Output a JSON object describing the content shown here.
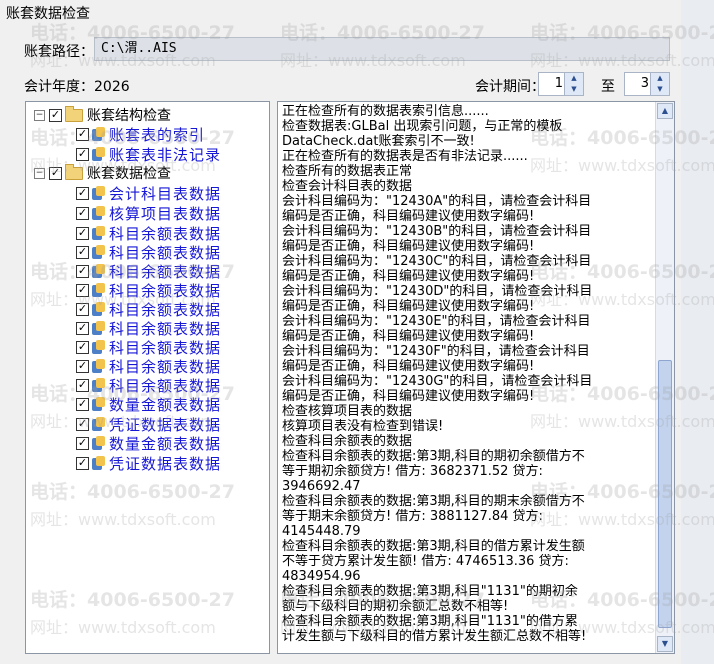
{
  "window": {
    "title": "账套数据检查"
  },
  "path": {
    "label": "账套路径：",
    "value": "C:\\渭..AIS"
  },
  "fiscal_year": {
    "label": "会计年度：",
    "value": "2026"
  },
  "period": {
    "label": "会计期间：",
    "from": "1",
    "to_label": "至",
    "to": "3"
  },
  "tree": {
    "items": [
      {
        "label": "账套结构检查",
        "level": 0,
        "type": "folder",
        "checked": true,
        "expander": "−"
      },
      {
        "label": "账套表的索引",
        "level": 1,
        "type": "db",
        "checked": true
      },
      {
        "label": "账套表非法记录",
        "level": 1,
        "type": "db",
        "checked": true
      },
      {
        "label": "账套数据检查",
        "level": 0,
        "type": "folder",
        "checked": true,
        "expander": "−"
      },
      {
        "label": "会计科目表数据",
        "level": 1,
        "type": "db",
        "checked": true
      },
      {
        "label": "核算项目表数据",
        "level": 1,
        "type": "db",
        "checked": true
      },
      {
        "label": "科目余额表数据",
        "level": 1,
        "type": "db",
        "checked": true
      },
      {
        "label": "科目余额表数据",
        "level": 1,
        "type": "db",
        "checked": true
      },
      {
        "label": "科目余额表数据",
        "level": 1,
        "type": "db",
        "checked": true
      },
      {
        "label": "科目余额表数据",
        "level": 1,
        "type": "db",
        "checked": true
      },
      {
        "label": "科目余额表数据",
        "level": 1,
        "type": "db",
        "checked": true
      },
      {
        "label": "科目余额表数据",
        "level": 1,
        "type": "db",
        "checked": true
      },
      {
        "label": "科目余额表数据",
        "level": 1,
        "type": "db",
        "checked": true
      },
      {
        "label": "科目余额表数据",
        "level": 1,
        "type": "db",
        "checked": true
      },
      {
        "label": "科目余额表数据",
        "level": 1,
        "type": "db",
        "checked": true
      },
      {
        "label": "数量金额表数据",
        "level": 1,
        "type": "db",
        "checked": true
      },
      {
        "label": "凭证数据表数据",
        "level": 1,
        "type": "db",
        "checked": true
      },
      {
        "label": "数量金额表数据",
        "level": 1,
        "type": "db",
        "checked": true
      },
      {
        "label": "凭证数据表数据",
        "level": 1,
        "type": "db",
        "checked": true
      }
    ]
  },
  "log": {
    "lines": [
      "正在检查所有的数据表索引信息......",
      "    检查数据表:GLBal 出现索引问题，与正常的模板",
      "DataCheck.dat账套索引不一致!",
      "正在检查所有的数据表是否有非法记录......",
      "    检查所有的数据表正常",
      "检查会计科目表的数据",
      "会计科目编码为：\"12430A\"的科目，请检查会计科目",
      "编码是否正确，科目编码建议使用数字编码!",
      "会计科目编码为：\"12430B\"的科目，请检查会计科目",
      "编码是否正确，科目编码建议使用数字编码!",
      "会计科目编码为：\"12430C\"的科目，请检查会计科目",
      "编码是否正确，科目编码建议使用数字编码!",
      "会计科目编码为：\"12430D\"的科目，请检查会计科目",
      "编码是否正确，科目编码建议使用数字编码!",
      "会计科目编码为：\"12430E\"的科目，请检查会计科目",
      "编码是否正确，科目编码建议使用数字编码!",
      "会计科目编码为：\"12430F\"的科目，请检查会计科目",
      "编码是否正确，科目编码建议使用数字编码!",
      "会计科目编码为：\"12430G\"的科目，请检查会计科目",
      "编码是否正确，科目编码建议使用数字编码!",
      "检查核算项目表的数据",
      "    核算项目表没有检查到错误!",
      "检查科目余额表的数据",
      "    检查科目余额表的数据:第3期,科目的期初余额借方不",
      "等于期初余额贷方! 借方: 3682371.52 贷方:",
      "3946692.47",
      "    检查科目余额表的数据:第3期,科目的期末余额借方不",
      "等于期末余额贷方! 借方: 3881127.84 贷方:",
      "4145448.79",
      "    检查科目余额表的数据:第3期,科目的借方累计发生额",
      "不等于贷方累计发生额! 借方: 4746513.36 贷方:",
      "4834954.96",
      "    检查科目余额表的数据:第3期,科目\"1131\"的期初余",
      "额与下级科目的期初余额汇总数不相等!",
      "    检查科目余额表的数据:第3期,科目\"1131\"的借方累",
      "计发生额与下级科目的借方累计发生额汇总数不相等!"
    ]
  },
  "watermark": {
    "phone": "电话：4006-6500-27",
    "site": "网址：www.tdxsoft.com"
  }
}
